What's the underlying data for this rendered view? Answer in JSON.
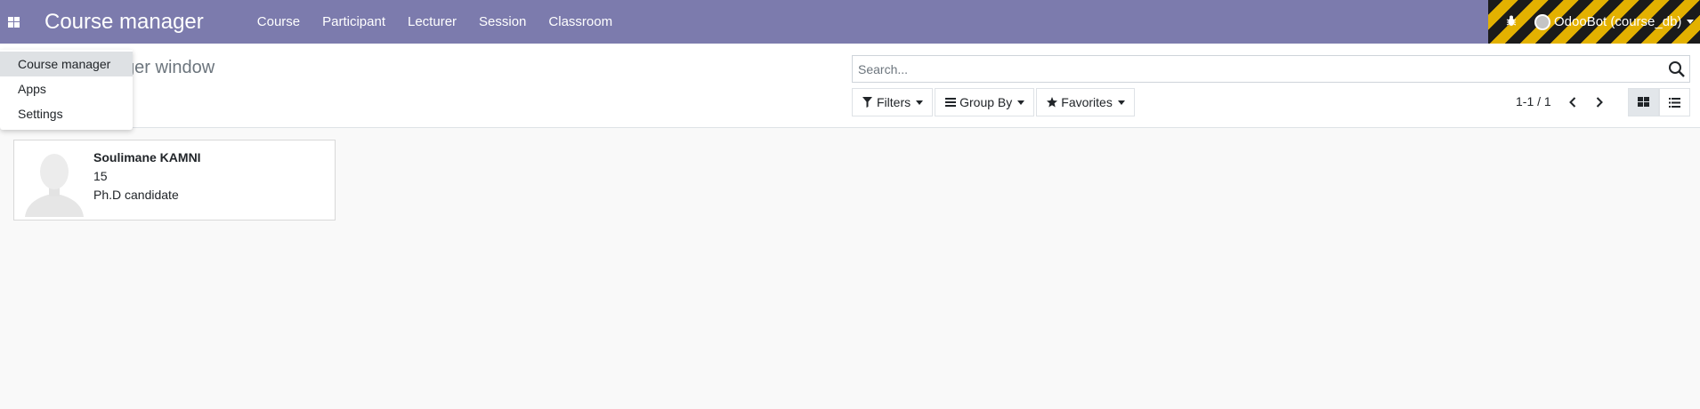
{
  "navbar": {
    "brand": "Course manager",
    "menu": [
      "Course",
      "Participant",
      "Lecturer",
      "Session",
      "Classroom"
    ],
    "user": "OdooBot (course_db)",
    "color": "#7c7bad"
  },
  "control_panel": {
    "title": "Course manager window",
    "search_placeholder": "Search...",
    "filters_label": "Filters",
    "groupby_label": "Group By",
    "favorites_label": "Favorites",
    "pager": "1-1 / 1"
  },
  "kanban": {
    "cards": [
      {
        "name": "Soulimane KAMNI",
        "line1": "15",
        "line2": "Ph.D candidate"
      }
    ]
  },
  "apps_dropdown": {
    "items": [
      "Course manager",
      "Apps",
      "Settings"
    ],
    "active_index": 0
  },
  "icons": {
    "apps": "grid-icon",
    "debug": "bug-icon",
    "search": "search-icon",
    "filter": "filter-icon",
    "groupby": "bars-icon",
    "favorites": "star-icon",
    "prev": "chevron-left-icon",
    "next": "chevron-right-icon",
    "kanban_view": "th-large-icon",
    "list_view": "list-icon"
  }
}
